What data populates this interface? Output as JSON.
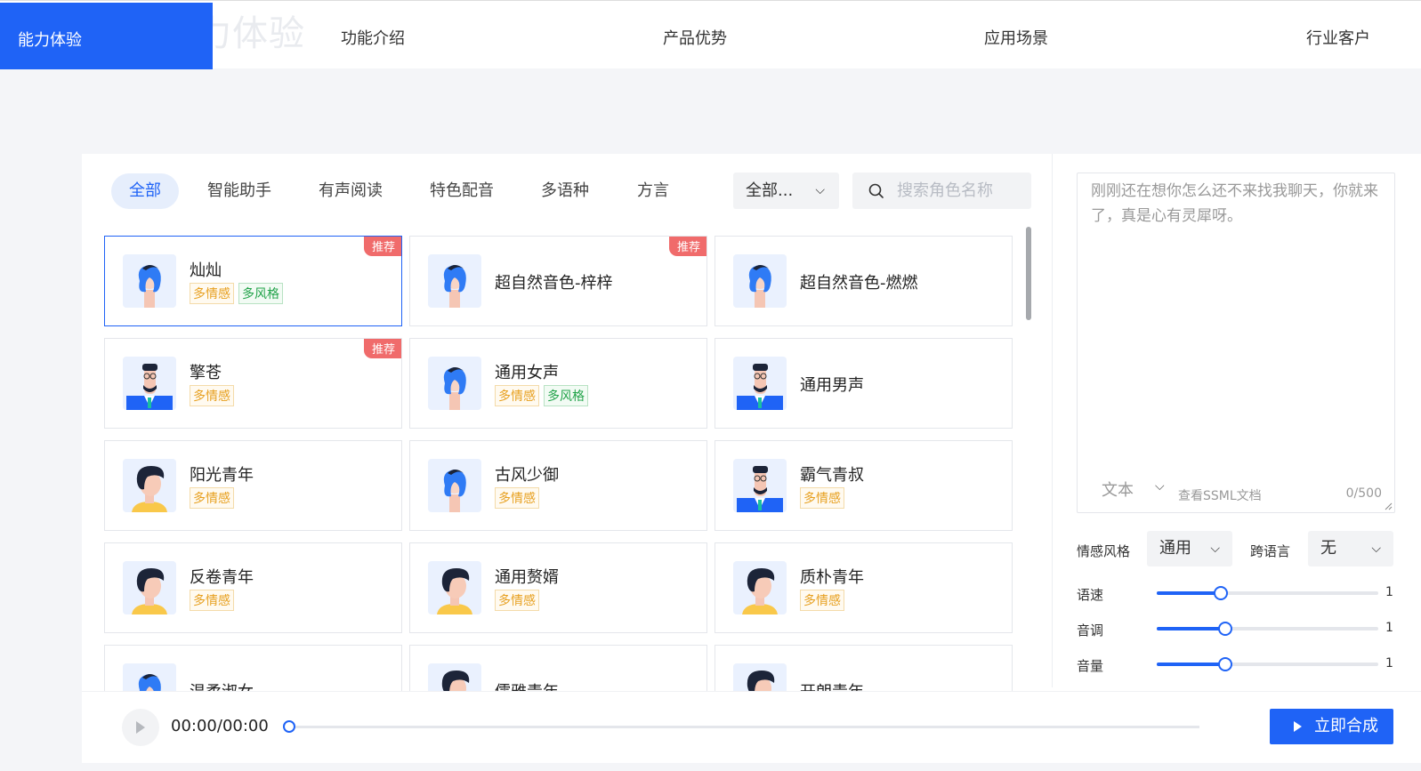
{
  "nav": {
    "active": "能力体验",
    "ghost": "力体验",
    "items": [
      "功能介绍",
      "产品优势",
      "应用场景",
      "行业客户"
    ]
  },
  "filters": {
    "tabs": [
      "全部",
      "智能助手",
      "有声阅读",
      "特色配音",
      "多语种",
      "方言"
    ],
    "active_tab": "全部",
    "select_value": "全部...",
    "search_placeholder": "搜索角色名称"
  },
  "voices": [
    {
      "name": "灿灿",
      "tags": [
        "多情感",
        "多风格"
      ],
      "badge": "推荐",
      "selected": true,
      "avatar": "female"
    },
    {
      "name": "超自然音色-梓梓",
      "tags": [],
      "badge": "推荐",
      "selected": false,
      "avatar": "female"
    },
    {
      "name": "超自然音色-燃燃",
      "tags": [],
      "badge": "",
      "selected": false,
      "avatar": "female"
    },
    {
      "name": "擎苍",
      "tags": [
        "多情感"
      ],
      "badge": "推荐",
      "selected": false,
      "avatar": "male-suit"
    },
    {
      "name": "通用女声",
      "tags": [
        "多情感",
        "多风格"
      ],
      "badge": "",
      "selected": false,
      "avatar": "female"
    },
    {
      "name": "通用男声",
      "tags": [],
      "badge": "",
      "selected": false,
      "avatar": "male-suit"
    },
    {
      "name": "阳光青年",
      "tags": [
        "多情感"
      ],
      "badge": "",
      "selected": false,
      "avatar": "young-male"
    },
    {
      "name": "古风少御",
      "tags": [
        "多情感"
      ],
      "badge": "",
      "selected": false,
      "avatar": "female"
    },
    {
      "name": "霸气青叔",
      "tags": [
        "多情感"
      ],
      "badge": "",
      "selected": false,
      "avatar": "male-suit"
    },
    {
      "name": "反卷青年",
      "tags": [
        "多情感"
      ],
      "badge": "",
      "selected": false,
      "avatar": "young-male"
    },
    {
      "name": "通用赘婿",
      "tags": [
        "多情感"
      ],
      "badge": "",
      "selected": false,
      "avatar": "young-male"
    },
    {
      "name": "质朴青年",
      "tags": [
        "多情感"
      ],
      "badge": "",
      "selected": false,
      "avatar": "young-male"
    },
    {
      "name": "温柔淑女",
      "tags": [],
      "badge": "",
      "selected": false,
      "avatar": "female"
    },
    {
      "name": "儒雅青年",
      "tags": [],
      "badge": "",
      "selected": false,
      "avatar": "young-male"
    },
    {
      "name": "开朗青年",
      "tags": [],
      "badge": "",
      "selected": false,
      "avatar": "young-male"
    }
  ],
  "editor": {
    "text": "刚刚还在想你怎么还不来找我聊天，你就来了，真是心有灵犀呀。",
    "mode": "文本",
    "ssml_link": "查看SSML文档",
    "count": "0/500"
  },
  "settings": {
    "emotion_label": "情感风格",
    "emotion_value": "通用",
    "cross_label": "跨语言",
    "cross_value": "无",
    "sliders": [
      {
        "label": "语速",
        "value": "1",
        "fraction": 0.29
      },
      {
        "label": "音调",
        "value": "1",
        "fraction": 0.31
      },
      {
        "label": "音量",
        "value": "1",
        "fraction": 0.31
      }
    ]
  },
  "player": {
    "time": "00:00/00:00",
    "progress": 0,
    "synth_label": "立即合成"
  },
  "colors": {
    "accent": "#1f63f6",
    "badge": "#f06b6b",
    "tag_orange": "#e7a020",
    "tag_green": "#22a34a"
  }
}
